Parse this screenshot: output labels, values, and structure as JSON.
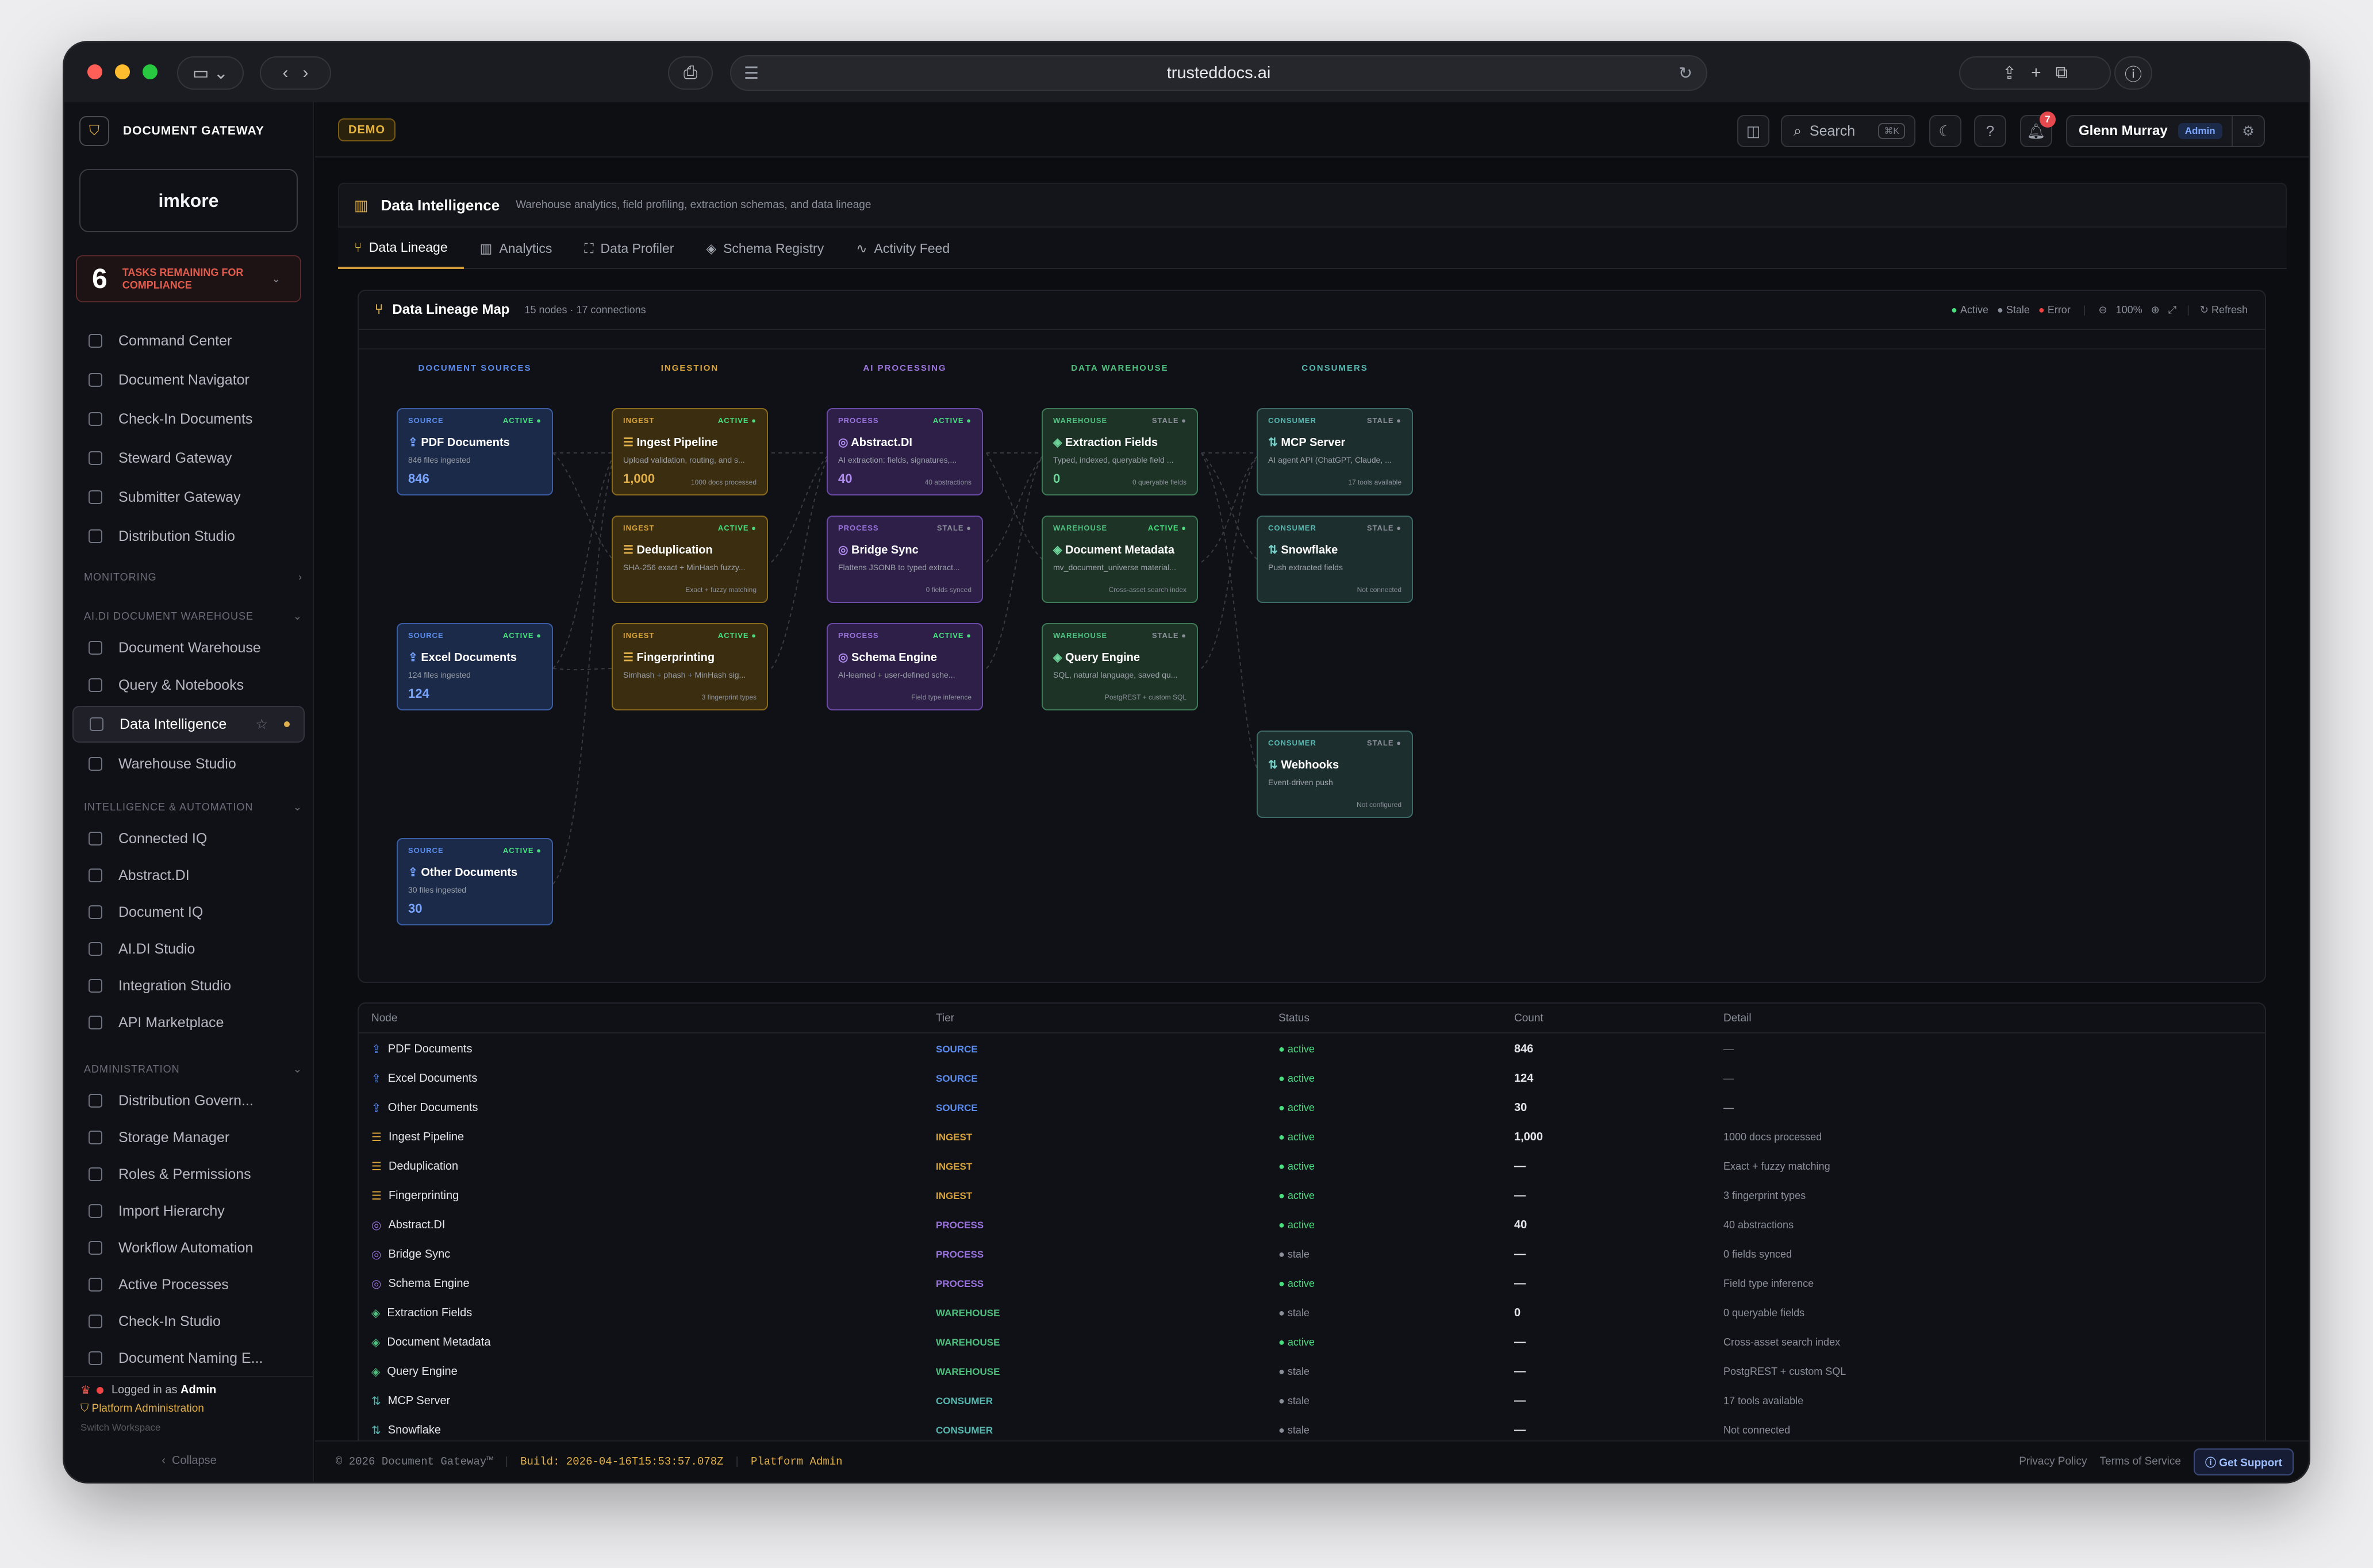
{
  "browser": {
    "url": "trusteddocs.ai"
  },
  "sidebar": {
    "brand": "DOCUMENT GATEWAY",
    "org_logo": "imkore",
    "tasks_count": "6",
    "tasks_label": "TASKS REMAINING FOR COMPLIANCE",
    "top_items": [
      {
        "label": "Command Center",
        "icon": "command-icon"
      },
      {
        "label": "Document Navigator",
        "icon": "navigator-icon"
      },
      {
        "label": "Check-In Documents",
        "icon": "upload-icon"
      },
      {
        "label": "Steward Gateway",
        "icon": "shield-icon"
      },
      {
        "label": "Submitter Gateway",
        "icon": "external-icon"
      },
      {
        "label": "Distribution Studio",
        "icon": "share-icon"
      }
    ],
    "sections": [
      {
        "label": "MONITORING"
      },
      {
        "label": "AI.DI DOCUMENT WAREHOUSE"
      },
      {
        "label": "INTELLIGENCE & AUTOMATION"
      },
      {
        "label": "ADMINISTRATION"
      }
    ],
    "warehouse_items": [
      {
        "label": "Document Warehouse"
      },
      {
        "label": "Query & Notebooks"
      },
      {
        "label": "Data Intelligence"
      },
      {
        "label": "Warehouse Studio"
      }
    ],
    "intel_items": [
      {
        "label": "Connected IQ"
      },
      {
        "label": "Abstract.DI"
      },
      {
        "label": "Document IQ"
      },
      {
        "label": "AI.DI Studio"
      },
      {
        "label": "Integration Studio"
      },
      {
        "label": "API Marketplace"
      }
    ],
    "admin_items": [
      {
        "label": "Distribution Govern..."
      },
      {
        "label": "Storage Manager"
      },
      {
        "label": "Roles & Permissions"
      },
      {
        "label": "Import Hierarchy"
      },
      {
        "label": "Workflow Automation"
      },
      {
        "label": "Active Processes"
      },
      {
        "label": "Check-In Studio"
      },
      {
        "label": "Document Naming E..."
      }
    ],
    "footer": {
      "logged_prefix": "Logged in as",
      "logged_user": "Admin",
      "platform": "Platform Administration",
      "switch": "Switch Workspace",
      "collapse": "Collapse"
    }
  },
  "topbar": {
    "demo_badge": "DEMO",
    "search_label": "Search",
    "search_shortcut": "⌘K",
    "notif_count": "7",
    "user_name": "Glenn Murray",
    "user_role": "Admin"
  },
  "page": {
    "title": "Data Intelligence",
    "subtitle": "Warehouse analytics, field profiling, extraction schemas, and data lineage",
    "tabs": [
      {
        "label": "Data Lineage"
      },
      {
        "label": "Analytics"
      },
      {
        "label": "Data Profiler"
      },
      {
        "label": "Schema Registry"
      },
      {
        "label": "Activity Feed"
      }
    ]
  },
  "lineage": {
    "title": "Data Lineage Map",
    "stats": "15 nodes · 17 connections",
    "legend": {
      "active": "Active",
      "stale": "Stale",
      "error": "Error"
    },
    "zoom": "100%",
    "refresh": "Refresh",
    "columns": [
      {
        "label": "DOCUMENT SOURCES",
        "color": "#5b8def"
      },
      {
        "label": "INGESTION",
        "color": "#d9a33b"
      },
      {
        "label": "AI PROCESSING",
        "color": "#9b74e0"
      },
      {
        "label": "DATA WAREHOUSE",
        "color": "#4fbf7f"
      },
      {
        "label": "CONSUMERS",
        "color": "#56b8b0"
      }
    ],
    "nodes": [
      {
        "tier": "SOURCE",
        "status": "ACTIVE",
        "name": "PDF Documents",
        "desc": "846 files ingested",
        "count": "846",
        "sub": ""
      },
      {
        "tier": "SOURCE",
        "status": "ACTIVE",
        "name": "Excel Documents",
        "desc": "124 files ingested",
        "count": "124",
        "sub": ""
      },
      {
        "tier": "SOURCE",
        "status": "ACTIVE",
        "name": "Other Documents",
        "desc": "30 files ingested",
        "count": "30",
        "sub": ""
      },
      {
        "tier": "INGEST",
        "status": "ACTIVE",
        "name": "Ingest Pipeline",
        "desc": "Upload validation, routing, and s...",
        "count": "1,000",
        "sub": "1000 docs processed"
      },
      {
        "tier": "INGEST",
        "status": "ACTIVE",
        "name": "Deduplication",
        "desc": "SHA-256 exact + MinHash fuzzy...",
        "count": "",
        "sub": "Exact + fuzzy matching"
      },
      {
        "tier": "INGEST",
        "status": "ACTIVE",
        "name": "Fingerprinting",
        "desc": "Simhash + phash + MinHash sig...",
        "count": "",
        "sub": "3 fingerprint types"
      },
      {
        "tier": "PROCESS",
        "status": "ACTIVE",
        "name": "Abstract.DI",
        "desc": "AI extraction: fields, signatures,...",
        "count": "40",
        "sub": "40 abstractions"
      },
      {
        "tier": "PROCESS",
        "status": "STALE",
        "name": "Bridge Sync",
        "desc": "Flattens JSONB to typed extract...",
        "count": "",
        "sub": "0 fields synced"
      },
      {
        "tier": "PROCESS",
        "status": "ACTIVE",
        "name": "Schema Engine",
        "desc": "AI-learned + user-defined sche...",
        "count": "",
        "sub": "Field type inference"
      },
      {
        "tier": "WAREHOUSE",
        "status": "STALE",
        "name": "Extraction Fields",
        "desc": "Typed, indexed, queryable field ...",
        "count": "0",
        "sub": "0 queryable fields"
      },
      {
        "tier": "WAREHOUSE",
        "status": "ACTIVE",
        "name": "Document Metadata",
        "desc": "mv_document_universe material...",
        "count": "",
        "sub": "Cross-asset search index"
      },
      {
        "tier": "WAREHOUSE",
        "status": "STALE",
        "name": "Query Engine",
        "desc": "SQL, natural language, saved qu...",
        "count": "",
        "sub": "PostgREST + custom SQL"
      },
      {
        "tier": "CONSUMER",
        "status": "STALE",
        "name": "MCP Server",
        "desc": "AI agent API (ChatGPT, Claude, ...",
        "count": "",
        "sub": "17 tools available"
      },
      {
        "tier": "CONSUMER",
        "status": "STALE",
        "name": "Snowflake",
        "desc": "Push extracted fields",
        "count": "",
        "sub": "Not connected"
      },
      {
        "tier": "CONSUMER",
        "status": "STALE",
        "name": "Webhooks",
        "desc": "Event-driven push",
        "count": "",
        "sub": "Not configured"
      }
    ]
  },
  "table": {
    "headers": [
      "Node",
      "Tier",
      "Status",
      "Count",
      "Detail"
    ],
    "rows": [
      {
        "node": "PDF Documents",
        "tier": "SOURCE",
        "status": "active",
        "count": "846",
        "detail": "—"
      },
      {
        "node": "Excel Documents",
        "tier": "SOURCE",
        "status": "active",
        "count": "124",
        "detail": "—"
      },
      {
        "node": "Other Documents",
        "tier": "SOURCE",
        "status": "active",
        "count": "30",
        "detail": "—"
      },
      {
        "node": "Ingest Pipeline",
        "tier": "INGEST",
        "status": "active",
        "count": "1,000",
        "detail": "1000 docs processed"
      },
      {
        "node": "Deduplication",
        "tier": "INGEST",
        "status": "active",
        "count": "—",
        "detail": "Exact + fuzzy matching"
      },
      {
        "node": "Fingerprinting",
        "tier": "INGEST",
        "status": "active",
        "count": "—",
        "detail": "3 fingerprint types"
      },
      {
        "node": "Abstract.DI",
        "tier": "PROCESS",
        "status": "active",
        "count": "40",
        "detail": "40 abstractions"
      },
      {
        "node": "Bridge Sync",
        "tier": "PROCESS",
        "status": "stale",
        "count": "—",
        "detail": "0 fields synced"
      },
      {
        "node": "Schema Engine",
        "tier": "PROCESS",
        "status": "active",
        "count": "—",
        "detail": "Field type inference"
      },
      {
        "node": "Extraction Fields",
        "tier": "WAREHOUSE",
        "status": "stale",
        "count": "0",
        "detail": "0 queryable fields"
      },
      {
        "node": "Document Metadata",
        "tier": "WAREHOUSE",
        "status": "active",
        "count": "—",
        "detail": "Cross-asset search index"
      },
      {
        "node": "Query Engine",
        "tier": "WAREHOUSE",
        "status": "stale",
        "count": "—",
        "detail": "PostgREST + custom SQL"
      },
      {
        "node": "MCP Server",
        "tier": "CONSUMER",
        "status": "stale",
        "count": "—",
        "detail": "17 tools available"
      },
      {
        "node": "Snowflake",
        "tier": "CONSUMER",
        "status": "stale",
        "count": "—",
        "detail": "Not connected"
      }
    ]
  },
  "footer": {
    "copyright": "© 2026 Document Gateway™",
    "build": "Build: 2026-04-16T15:53:57.078Z",
    "role": "Platform Admin",
    "privacy": "Privacy Policy",
    "terms": "Terms of Service",
    "support": "Get Support"
  },
  "colors": {
    "source": "#5b8def",
    "ingest": "#d9a33b",
    "process": "#9b74e0",
    "warehouse": "#4fbf7f",
    "consumer": "#56b8b0",
    "active": "#4ade80",
    "stale": "#8b8f99",
    "error": "#ef4444"
  }
}
